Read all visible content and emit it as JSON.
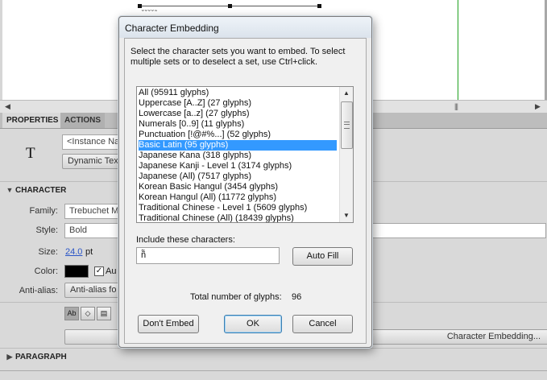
{
  "stage": {
    "selection_text": "˘˘˘˘˜",
    "h_scroll_left": "◀",
    "h_scroll_right": "▶",
    "h_scroll_grip": "|||"
  },
  "panel": {
    "tabs": [
      {
        "label": "PROPERTIES",
        "active": true
      },
      {
        "label": "ACTIONS",
        "active": false
      }
    ],
    "type_icon_glyph": "T",
    "instance_name_placeholder": "<Instance Na",
    "text_type_dropdown": "Dynamic Tex",
    "character_section": {
      "title": "CHARACTER",
      "expand_glyph": "▼",
      "family_label": "Family:",
      "family_value": "Trebuchet M",
      "style_label": "Style:",
      "style_value": "Bold",
      "size_label": "Size:",
      "size_value": "24.0",
      "size_unit": "pt",
      "color_label": "Color:",
      "color_value": "#000000",
      "auto_kern_label": "Au",
      "auto_kern_checked": true,
      "antialias_label": "Anti-alias:",
      "antialias_value": "Anti-alias fo"
    },
    "format_buttons": [
      {
        "glyph": "Ab",
        "icon": "selectable-text-icon",
        "active": true
      },
      {
        "glyph": "◇",
        "icon": "render-html-icon",
        "active": false
      },
      {
        "glyph": "▤",
        "icon": "show-border-icon",
        "active": false
      }
    ],
    "character_embedding_button": "Character Embedding...",
    "paragraph_section": {
      "title": "PARAGRAPH",
      "expand_glyph": "▶"
    }
  },
  "dialog": {
    "title": "Character Embedding",
    "instructions": "Select the character sets you want to embed. To select multiple sets or to deselect a set, use Ctrl+click.",
    "character_sets": [
      {
        "label": "All  (95911 glyphs)",
        "selected": false
      },
      {
        "label": "Uppercase [A..Z]  (27 glyphs)",
        "selected": false
      },
      {
        "label": "Lowercase [a..z]  (27 glyphs)",
        "selected": false
      },
      {
        "label": "Numerals [0..9]  (11 glyphs)",
        "selected": false
      },
      {
        "label": "Punctuation [!@#%...]  (52 glyphs)",
        "selected": false
      },
      {
        "label": "Basic Latin  (95 glyphs)",
        "selected": true
      },
      {
        "label": "Japanese Kana  (318 glyphs)",
        "selected": false
      },
      {
        "label": "Japanese Kanji - Level 1 (3174 glyphs)",
        "selected": false
      },
      {
        "label": "Japanese (All)  (7517 glyphs)",
        "selected": false
      },
      {
        "label": "Korean Basic Hangul (3454 glyphs)",
        "selected": false
      },
      {
        "label": "Korean Hangul (All) (11772 glyphs)",
        "selected": false
      },
      {
        "label": "Traditional Chinese - Level 1 (5609 glyphs)",
        "selected": false
      },
      {
        "label": "Traditional Chinese (All)  (18439 glyphs)",
        "selected": false
      }
    ],
    "scroll_up": "▲",
    "scroll_down": "▼",
    "include_label": "Include these characters:",
    "include_value": "ñ̃",
    "auto_fill_button": "Auto Fill",
    "total_label": "Total number of glyphs:",
    "total_value": "96",
    "dont_embed_button": "Don't Embed",
    "ok_button": "OK",
    "cancel_button": "Cancel"
  },
  "colors": {
    "selection_highlight": "#3399ff",
    "guide_line": "#1fa11f",
    "link_value": "#2a55c7"
  }
}
